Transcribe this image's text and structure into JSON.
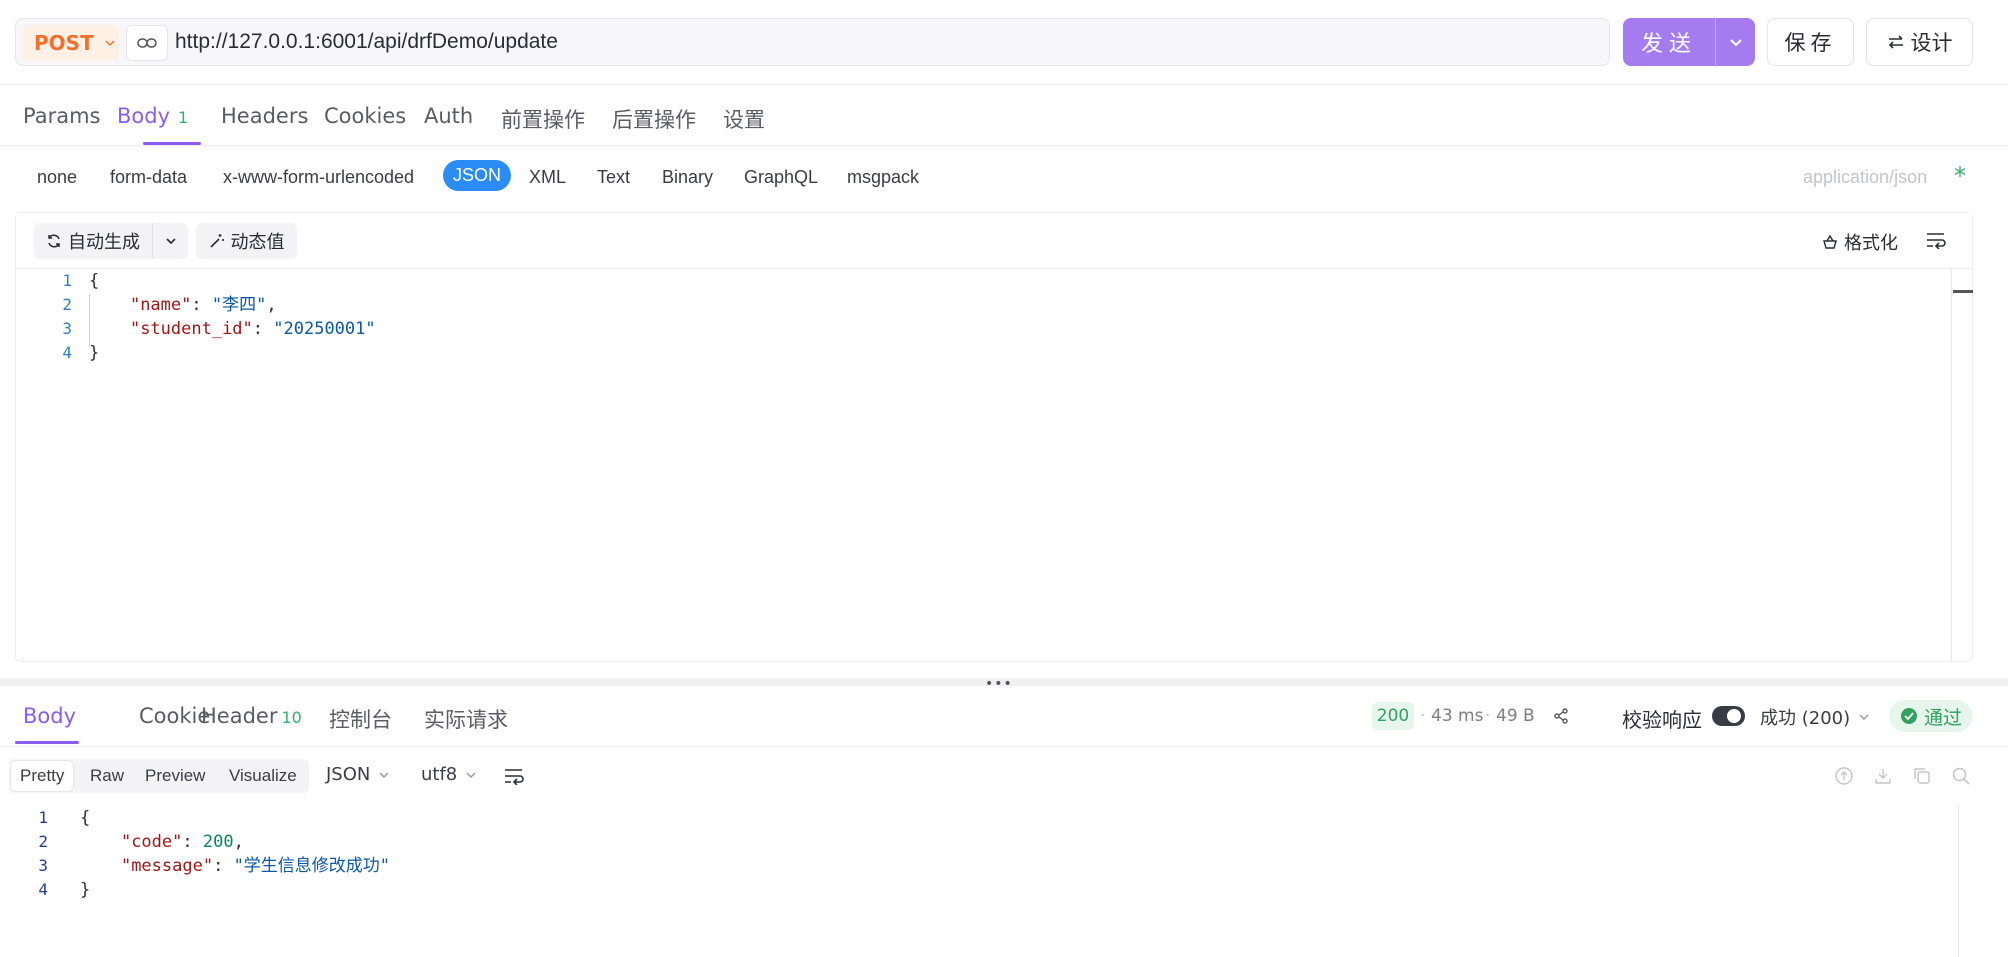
{
  "request": {
    "method": "POST",
    "url": "http://127.0.0.1:6001/api/drfDemo/update",
    "send_label": "发送",
    "save_label": "保存",
    "design_label": "设计"
  },
  "request_tabs": [
    {
      "label": "Params"
    },
    {
      "label": "Body",
      "count": "1",
      "active": true
    },
    {
      "label": "Headers"
    },
    {
      "label": "Cookies"
    },
    {
      "label": "Auth"
    },
    {
      "label": "前置操作"
    },
    {
      "label": "后置操作"
    },
    {
      "label": "设置"
    }
  ],
  "body_types": [
    "none",
    "form-data",
    "x-www-form-urlencoded",
    "JSON",
    "XML",
    "Text",
    "Binary",
    "GraphQL",
    "msgpack"
  ],
  "body_type_selected": "JSON",
  "content_type": "application/json",
  "required_mark": "*",
  "editor": {
    "auto_generate_label": "自动生成",
    "dynamic_value_label": "动态值",
    "format_label": "格式化",
    "lines": [
      {
        "num": "1",
        "tokens": [
          {
            "t": "{",
            "c": "p"
          }
        ]
      },
      {
        "num": "2",
        "tokens": [
          {
            "t": "    ",
            "c": "p"
          },
          {
            "t": "\"name\"",
            "c": "k"
          },
          {
            "t": ": ",
            "c": "p"
          },
          {
            "t": "\"李四\"",
            "c": "s"
          },
          {
            "t": ",",
            "c": "p"
          }
        ]
      },
      {
        "num": "3",
        "tokens": [
          {
            "t": "    ",
            "c": "p"
          },
          {
            "t": "\"student_id\"",
            "c": "k"
          },
          {
            "t": ": ",
            "c": "p"
          },
          {
            "t": "\"20250001\"",
            "c": "s"
          }
        ]
      },
      {
        "num": "4",
        "tokens": [
          {
            "t": "}",
            "c": "p"
          }
        ]
      }
    ]
  },
  "response_tabs": [
    {
      "label": "Body",
      "active": true
    },
    {
      "label": "Cookie"
    },
    {
      "label": "Header",
      "count": "10"
    },
    {
      "label": "控制台"
    },
    {
      "label": "实际请求"
    }
  ],
  "response_meta": {
    "status": "200",
    "time": "43 ms",
    "size": "49 B",
    "validate_label": "校验响应",
    "validate_enabled": true,
    "result_select": "成功 (200)",
    "pass_label": "通过"
  },
  "response_view": {
    "modes": [
      "Pretty",
      "Raw",
      "Preview",
      "Visualize"
    ],
    "mode_selected": "Pretty",
    "format": "JSON",
    "encoding": "utf8"
  },
  "response_body": {
    "lines": [
      {
        "num": "1",
        "tokens": [
          {
            "t": "{",
            "c": "p"
          }
        ]
      },
      {
        "num": "2",
        "tokens": [
          {
            "t": "    ",
            "c": "p"
          },
          {
            "t": "\"code\"",
            "c": "k"
          },
          {
            "t": ": ",
            "c": "p"
          },
          {
            "t": "200",
            "c": "n"
          },
          {
            "t": ",",
            "c": "p"
          }
        ]
      },
      {
        "num": "3",
        "tokens": [
          {
            "t": "    ",
            "c": "p"
          },
          {
            "t": "\"message\"",
            "c": "k"
          },
          {
            "t": ": ",
            "c": "p"
          },
          {
            "t": "\"学生信息修改成功\"",
            "c": "s"
          }
        ]
      },
      {
        "num": "4",
        "tokens": [
          {
            "t": "}",
            "c": "p"
          }
        ]
      }
    ]
  },
  "colors": {
    "accent": "#8a5cf0",
    "send": "#a57cf0",
    "method": "#f2702b",
    "json_pill": "#2b8cf5",
    "success": "#32a060"
  }
}
